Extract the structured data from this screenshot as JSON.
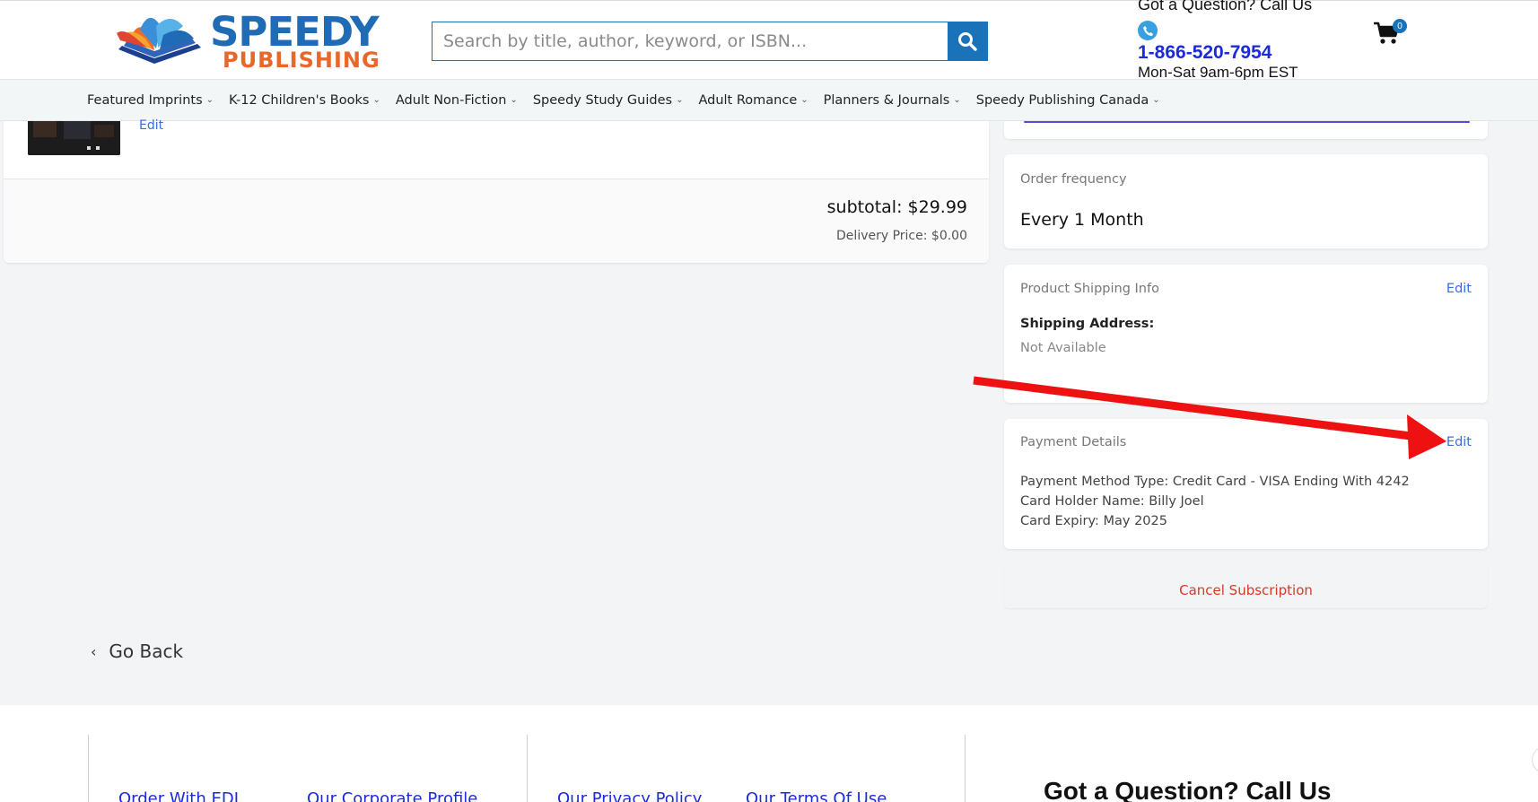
{
  "header": {
    "logo_top": "SPEEDY",
    "logo_bottom": "PUBLISHING",
    "search_placeholder": "Search by title, author, keyword, or ISBN...",
    "contact_question": "Got a Question? Call Us",
    "phone": "1-866-520-7954",
    "hours": "Mon-Sat 9am-6pm EST",
    "cart_count": "0"
  },
  "nav": {
    "items": [
      {
        "label": "Featured Imprints"
      },
      {
        "label": "K-12 Children's Books"
      },
      {
        "label": "Adult Non-Fiction"
      },
      {
        "label": "Speedy Study Guides"
      },
      {
        "label": "Adult Romance"
      },
      {
        "label": "Planners & Journals"
      },
      {
        "label": "Speedy Publishing Canada"
      }
    ]
  },
  "order": {
    "item_edit": "Edit",
    "subtotal": "subtotal: $29.99",
    "delivery": "Delivery Price: $0.00"
  },
  "frequency": {
    "label": "Order frequency",
    "value": "Every 1 Month"
  },
  "shipping": {
    "label": "Product Shipping Info",
    "edit": "Edit",
    "address_label": "Shipping Address:",
    "address_value": "Not Available"
  },
  "payment": {
    "label": "Payment Details",
    "edit": "Edit",
    "method": "Payment Method Type: Credit Card - VISA Ending With 4242",
    "holder": "Card Holder Name: Billy Joel",
    "expiry": "Card Expiry: May 2025"
  },
  "cancel": {
    "label": "Cancel Subscription"
  },
  "go_back": "Go Back",
  "footer": {
    "links": [
      "Order With EDI",
      "Our Corporate Profile",
      "Our Privacy Policy",
      "Our Terms Of Use"
    ],
    "call_heading": "Got a Question? Call Us"
  },
  "colors": {
    "brand_blue": "#1f6bb5",
    "brand_orange": "#e8672a",
    "link_blue": "#3a6fd8",
    "cancel_red": "#d53a26",
    "annotation_arrow": "#ee1111"
  }
}
